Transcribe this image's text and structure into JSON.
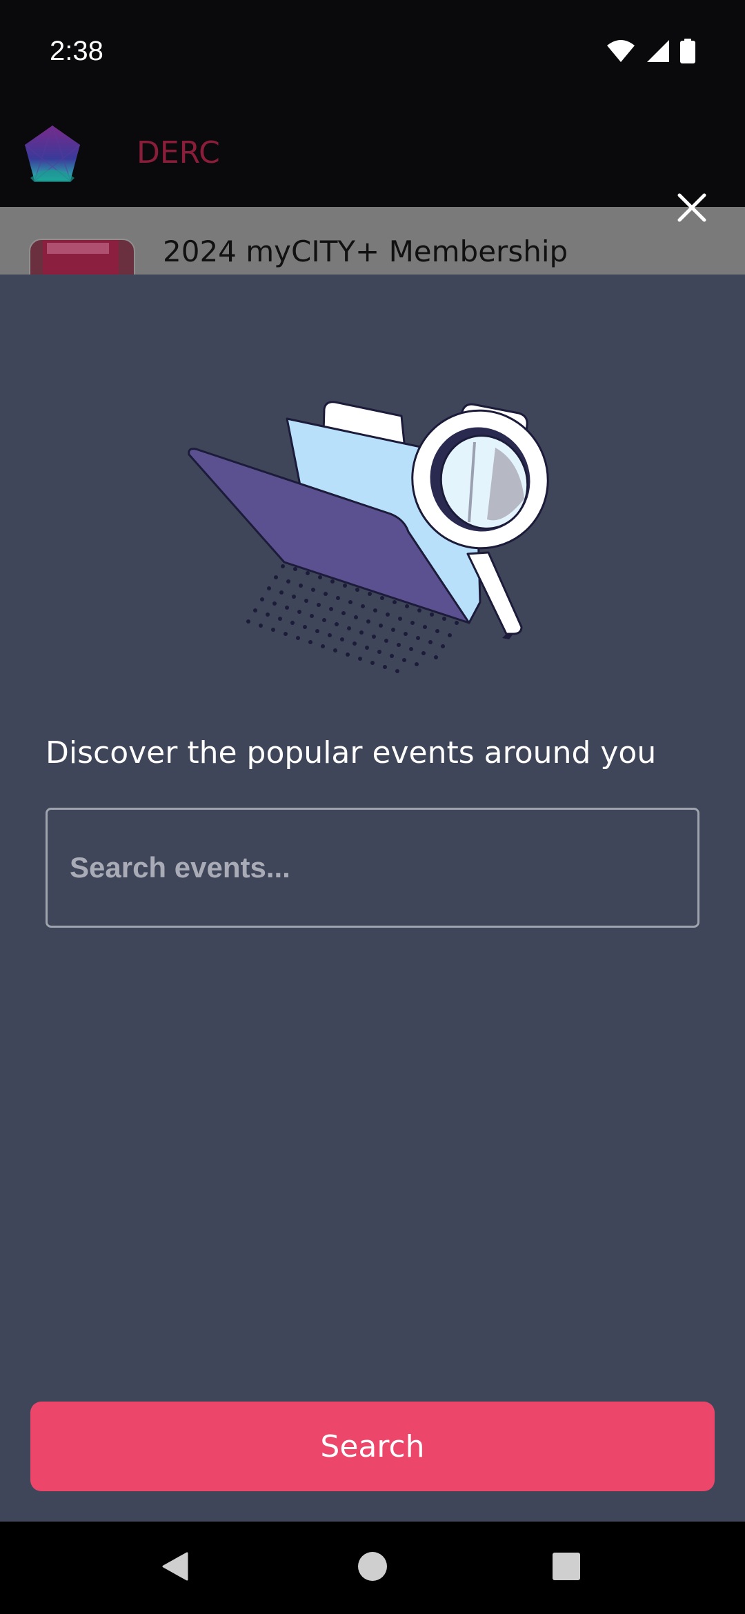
{
  "status_bar": {
    "time": "2:38",
    "icons": [
      "wifi-icon",
      "signal-icon",
      "battery-icon"
    ]
  },
  "header": {
    "title": "DERC",
    "title_color": "#8a1e3a"
  },
  "background_list": {
    "item_title": "2024 myCITY+ Membership"
  },
  "sheet": {
    "background_color": "#404659",
    "illustration": "folder-magnifier-illustration",
    "discover_text": "Discover the popular events around you",
    "search_placeholder": "Search events...",
    "search_value": "",
    "search_button_label": "Search",
    "search_button_color": "#ec466b"
  },
  "nav_bar": {
    "buttons": [
      "back-icon",
      "home-icon",
      "recents-icon"
    ]
  }
}
